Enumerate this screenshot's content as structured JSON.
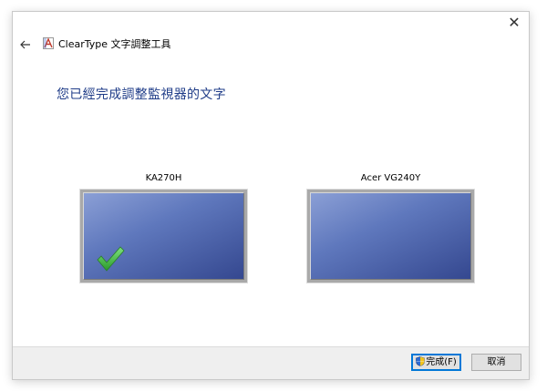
{
  "window": {
    "title": "ClearType 文字調整工具",
    "close_glyph": "✕"
  },
  "page": {
    "heading": "您已經完成調整監視器的文字"
  },
  "monitors": [
    {
      "label": "KA270H",
      "selected": true
    },
    {
      "label": "Acer VG240Y",
      "selected": false
    }
  ],
  "footer": {
    "finish_label": "完成(F)",
    "cancel_label": "取消"
  },
  "colors": {
    "heading": "#1f3c88",
    "monitor_gradient_light": "#8ca0d6",
    "monitor_gradient_dark": "#34478f",
    "checkmark": "#3cb93c",
    "footer_bg": "#efefef",
    "default_button_border": "#0078d7"
  },
  "icons": {
    "back": "arrow-left-icon",
    "app": "cleartype-icon",
    "close": "close-icon",
    "check": "checkmark-icon",
    "uac": "uac-shield-icon"
  }
}
